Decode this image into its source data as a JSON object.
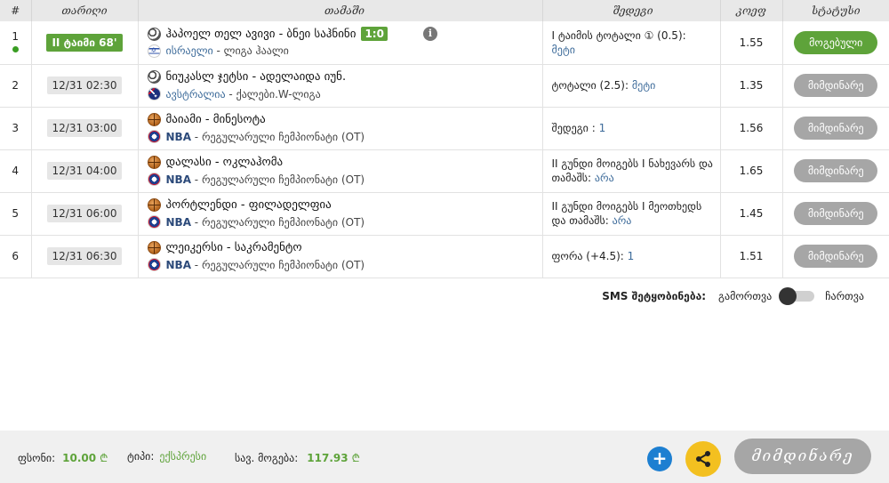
{
  "headers": {
    "num": "#",
    "date": "თარიღი",
    "game": "თამაში",
    "outcome": "შედეგი",
    "odds": "კოეფ",
    "status": "სტატუსი"
  },
  "rows": [
    {
      "num": "1",
      "date": "II ტაიმი 68'",
      "match": "ჰაპოელ თელ ავივი - ბნეი საჰნინი",
      "score": "1:0",
      "country": "ისრაელი",
      "league": "ლიგა ჰაალი",
      "outcome": "I ტაიმის ტოტალი ① (0.5):",
      "outcome_value": "მეტი",
      "odds": "1.55",
      "status": "მოგებული"
    },
    {
      "num": "2",
      "date": "12/31 02:30",
      "match": "ნიუკასლ ჯეტსი - ადელაიდა იუნ.",
      "country": "ავსტრალია",
      "league": "ქალები.W-ლიგა",
      "outcome": "ტოტალი (2.5):",
      "outcome_value": "მეტი",
      "odds": "1.35",
      "status": "მიმდინარე"
    },
    {
      "num": "3",
      "date": "12/31 03:00",
      "match": "მაიამი - მინესოტა",
      "country": "NBA",
      "league": "რეგულარული ჩემპიონატი (OT)",
      "outcome": "შედეგი :",
      "outcome_value": "1",
      "odds": "1.56",
      "status": "მიმდინარე"
    },
    {
      "num": "4",
      "date": "12/31 04:00",
      "match": "დალასი - ოკლაჰომა",
      "country": "NBA",
      "league": "რეგულარული ჩემპიონატი (OT)",
      "outcome": "II გუნდი მოიგებს I ნახევარს და თამაშს:",
      "outcome_value": "არა",
      "odds": "1.65",
      "status": "მიმდინარე"
    },
    {
      "num": "5",
      "date": "12/31 06:00",
      "match": "პორტლენდი - ფილადელფია",
      "country": "NBA",
      "league": "რეგულარული ჩემპიონატი (OT)",
      "outcome": "II გუნდი მოიგებს I მეოთხედს და თამაშს:",
      "outcome_value": "არა",
      "odds": "1.45",
      "status": "მიმდინარე"
    },
    {
      "num": "6",
      "date": "12/31 06:30",
      "match": "ლეიკერსი - საკრამენტო",
      "country": "NBA",
      "league": "რეგულარული ჩემპიონატი (OT)",
      "outcome": "ფორა (+4.5):",
      "outcome_value": "1",
      "odds": "1.51",
      "status": "მიმდინარე"
    }
  ],
  "sms": {
    "label": "SMS შეტყობინება:",
    "off": "გამორთვა",
    "on": "ჩართვა"
  },
  "footer": {
    "stake_label": "ფსონი:",
    "stake_value": "10.00",
    "type_label": "ტიპი:",
    "type_value": "ექსპრესი",
    "win_label": "სავ. მოგება:",
    "win_value": "117.93",
    "currency": "₾",
    "add_glyph": "+",
    "status": "მიმდინარე"
  },
  "colors": {
    "won": "#5ea33a",
    "pending": "#a6a6a6",
    "accent_blue": "#1d7fd1",
    "accent_yellow": "#f3c020"
  },
  "icons": [
    "soccer-ball-icon",
    "basketball-icon",
    "info-icon",
    "flag-icon",
    "plus-icon",
    "share-icon"
  ]
}
